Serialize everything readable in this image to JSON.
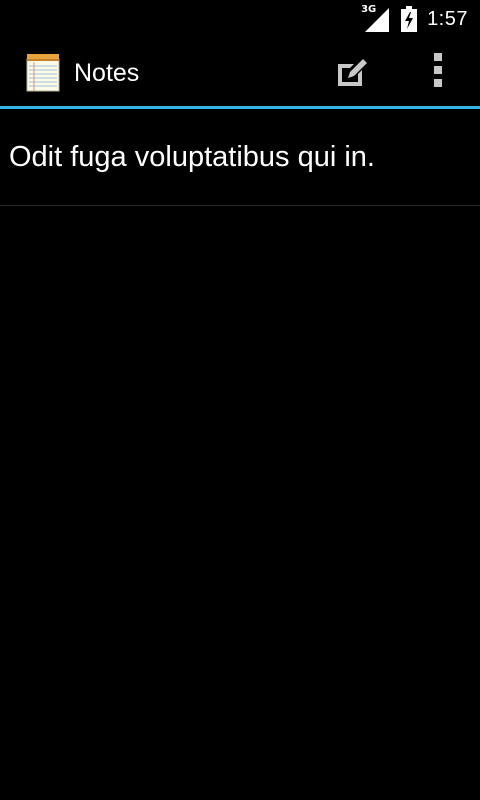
{
  "status_bar": {
    "network_type": "3G",
    "time": "1:57",
    "icons": [
      "signal-icon",
      "battery-charging-icon"
    ]
  },
  "action_bar": {
    "app_icon": "notepad-icon",
    "title": "Notes",
    "actions": [
      {
        "icon": "edit-note-icon",
        "label": "New note"
      },
      {
        "icon": "overflow-menu-icon",
        "label": "More options"
      }
    ],
    "accent_color": "#33b5e5"
  },
  "notes": [
    {
      "title": "Odit fuga voluptatibus qui in."
    }
  ]
}
